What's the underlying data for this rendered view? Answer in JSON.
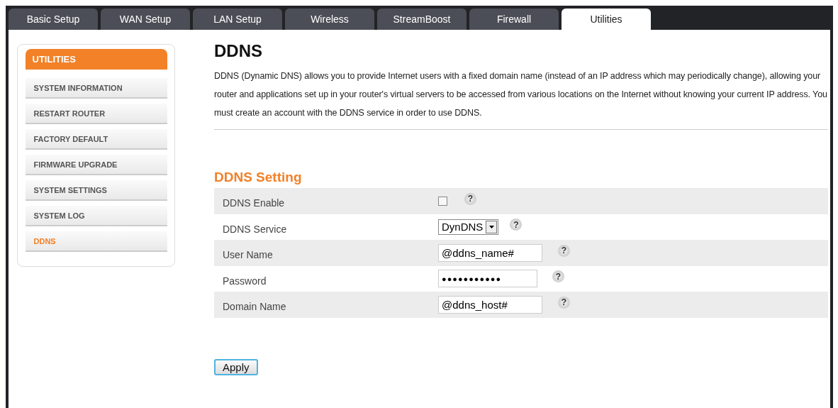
{
  "tabs": [
    {
      "label": "Basic Setup",
      "selected": false
    },
    {
      "label": "WAN Setup",
      "selected": false
    },
    {
      "label": "LAN Setup",
      "selected": false
    },
    {
      "label": "Wireless",
      "selected": false
    },
    {
      "label": "StreamBoost",
      "selected": false
    },
    {
      "label": "Firewall",
      "selected": false
    },
    {
      "label": "Utilities",
      "selected": true
    }
  ],
  "sidebar": {
    "title": "UTILITIES",
    "items": [
      {
        "label": "SYSTEM INFORMATION",
        "selected": false
      },
      {
        "label": "RESTART ROUTER",
        "selected": false
      },
      {
        "label": "FACTORY DEFAULT",
        "selected": false
      },
      {
        "label": "FIRMWARE UPGRADE",
        "selected": false
      },
      {
        "label": "SYSTEM SETTINGS",
        "selected": false
      },
      {
        "label": "SYSTEM LOG",
        "selected": false
      },
      {
        "label": "DDNS",
        "selected": true
      }
    ]
  },
  "title": "DDNS",
  "description": "DDNS (Dynamic DNS) allows you to provide Internet users with a fixed domain name (instead of an IP address which may periodically change), allowing your router and applications set up in your router's virtual servers to be accessed from various locations on the Internet without knowing your current IP address. You must create an account with the DDNS service in order to use DDNS.",
  "section_title": "DDNS Setting",
  "settings": [
    {
      "kind": "checkbox",
      "label": "DDNS Enable",
      "checked": false,
      "help": "?"
    },
    {
      "kind": "select",
      "label": "DDNS Service",
      "value": "DynDNS",
      "help": "?"
    },
    {
      "kind": "text",
      "label": "User Name",
      "value": "@ddns_name#",
      "help": "?"
    },
    {
      "kind": "password",
      "label": "Password",
      "value": "●●●●●●●●●●●",
      "help": "?"
    },
    {
      "kind": "text",
      "label": "Domain Name",
      "value": "@ddns_host#",
      "help": "?"
    }
  ],
  "apply_button": "Apply"
}
